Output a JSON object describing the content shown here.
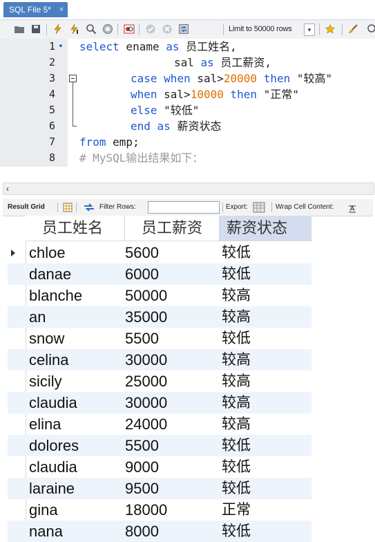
{
  "editor_tab": {
    "title": "SQL File 5*",
    "close": "×"
  },
  "toolbar": {
    "limit_label": "Limit to 50000 rows",
    "icons": [
      "folder-icon",
      "save-icon",
      "lightning-icon",
      "lightning-cursor-icon",
      "magnifier-icon",
      "stop-icon",
      "toggle-icon",
      "commit-icon",
      "rollback-icon",
      "autocommit-icon",
      "limit-dropdown",
      "star-icon",
      "brush-icon"
    ]
  },
  "editor": {
    "lines": [
      {
        "n": "1",
        "marker": "•"
      },
      {
        "n": "2"
      },
      {
        "n": "3"
      },
      {
        "n": "4"
      },
      {
        "n": "5"
      },
      {
        "n": "6"
      },
      {
        "n": "7"
      },
      {
        "n": "8"
      }
    ],
    "code": {
      "l1_kw1": "select",
      "l1_a": " ename ",
      "l1_kw2": "as",
      "l1_b": " 员工姓名,",
      "l2_a": "sal ",
      "l2_kw": "as",
      "l2_b": " 员工薪资,",
      "l3_kw1": "case",
      "l3_kw2": "when",
      "l3_a": " sal>",
      "l3_num": "20000",
      "l3_kw3": "then",
      "l3_str": " \"较高\"",
      "l4_kw1": "when",
      "l4_a": " sal>",
      "l4_num": "10000",
      "l4_kw2": "then",
      "l4_str": " \"正常\"",
      "l5_kw": "else",
      "l5_str": " \"较低\"",
      "l6_kw1": "end",
      "l6_kw2": "as",
      "l6_a": " 薪资状态",
      "l7_kw": "from",
      "l7_a": " emp;",
      "l8_cmt": "# MySQL输出结果如下："
    }
  },
  "hscroll": {
    "left_arrow": "‹"
  },
  "result_toolbar": {
    "result_grid": "Result Grid",
    "filter_rows": "Filter Rows:",
    "export": "Export:",
    "wrap": "Wrap Cell Content:"
  },
  "grid": {
    "columns": [
      "员工姓名",
      "员工薪资",
      "薪资状态"
    ],
    "rows": [
      [
        "chloe",
        "5600",
        "较低"
      ],
      [
        "danae",
        "6000",
        "较低"
      ],
      [
        "blanche",
        "50000",
        "较高"
      ],
      [
        "an",
        "35000",
        "较高"
      ],
      [
        "snow",
        "5500",
        "较低"
      ],
      [
        "celina",
        "30000",
        "较高"
      ],
      [
        "sicily",
        "25000",
        "较高"
      ],
      [
        "claudia",
        "30000",
        "较高"
      ],
      [
        "elina",
        "24000",
        "较高"
      ],
      [
        "dolores",
        "5500",
        "较低"
      ],
      [
        "claudia",
        "9000",
        "较低"
      ],
      [
        "laraine",
        "9500",
        "较低"
      ],
      [
        "gina",
        "18000",
        "正常"
      ],
      [
        "nana",
        "8000",
        "较低"
      ]
    ]
  },
  "colors": {
    "tab_blue": "#4a7fc2",
    "keyword": "#1f57d4",
    "number": "#e07000",
    "comment": "#9a9a9a",
    "header_active": "#d4dcef",
    "row_alt": "#eef4fb"
  }
}
